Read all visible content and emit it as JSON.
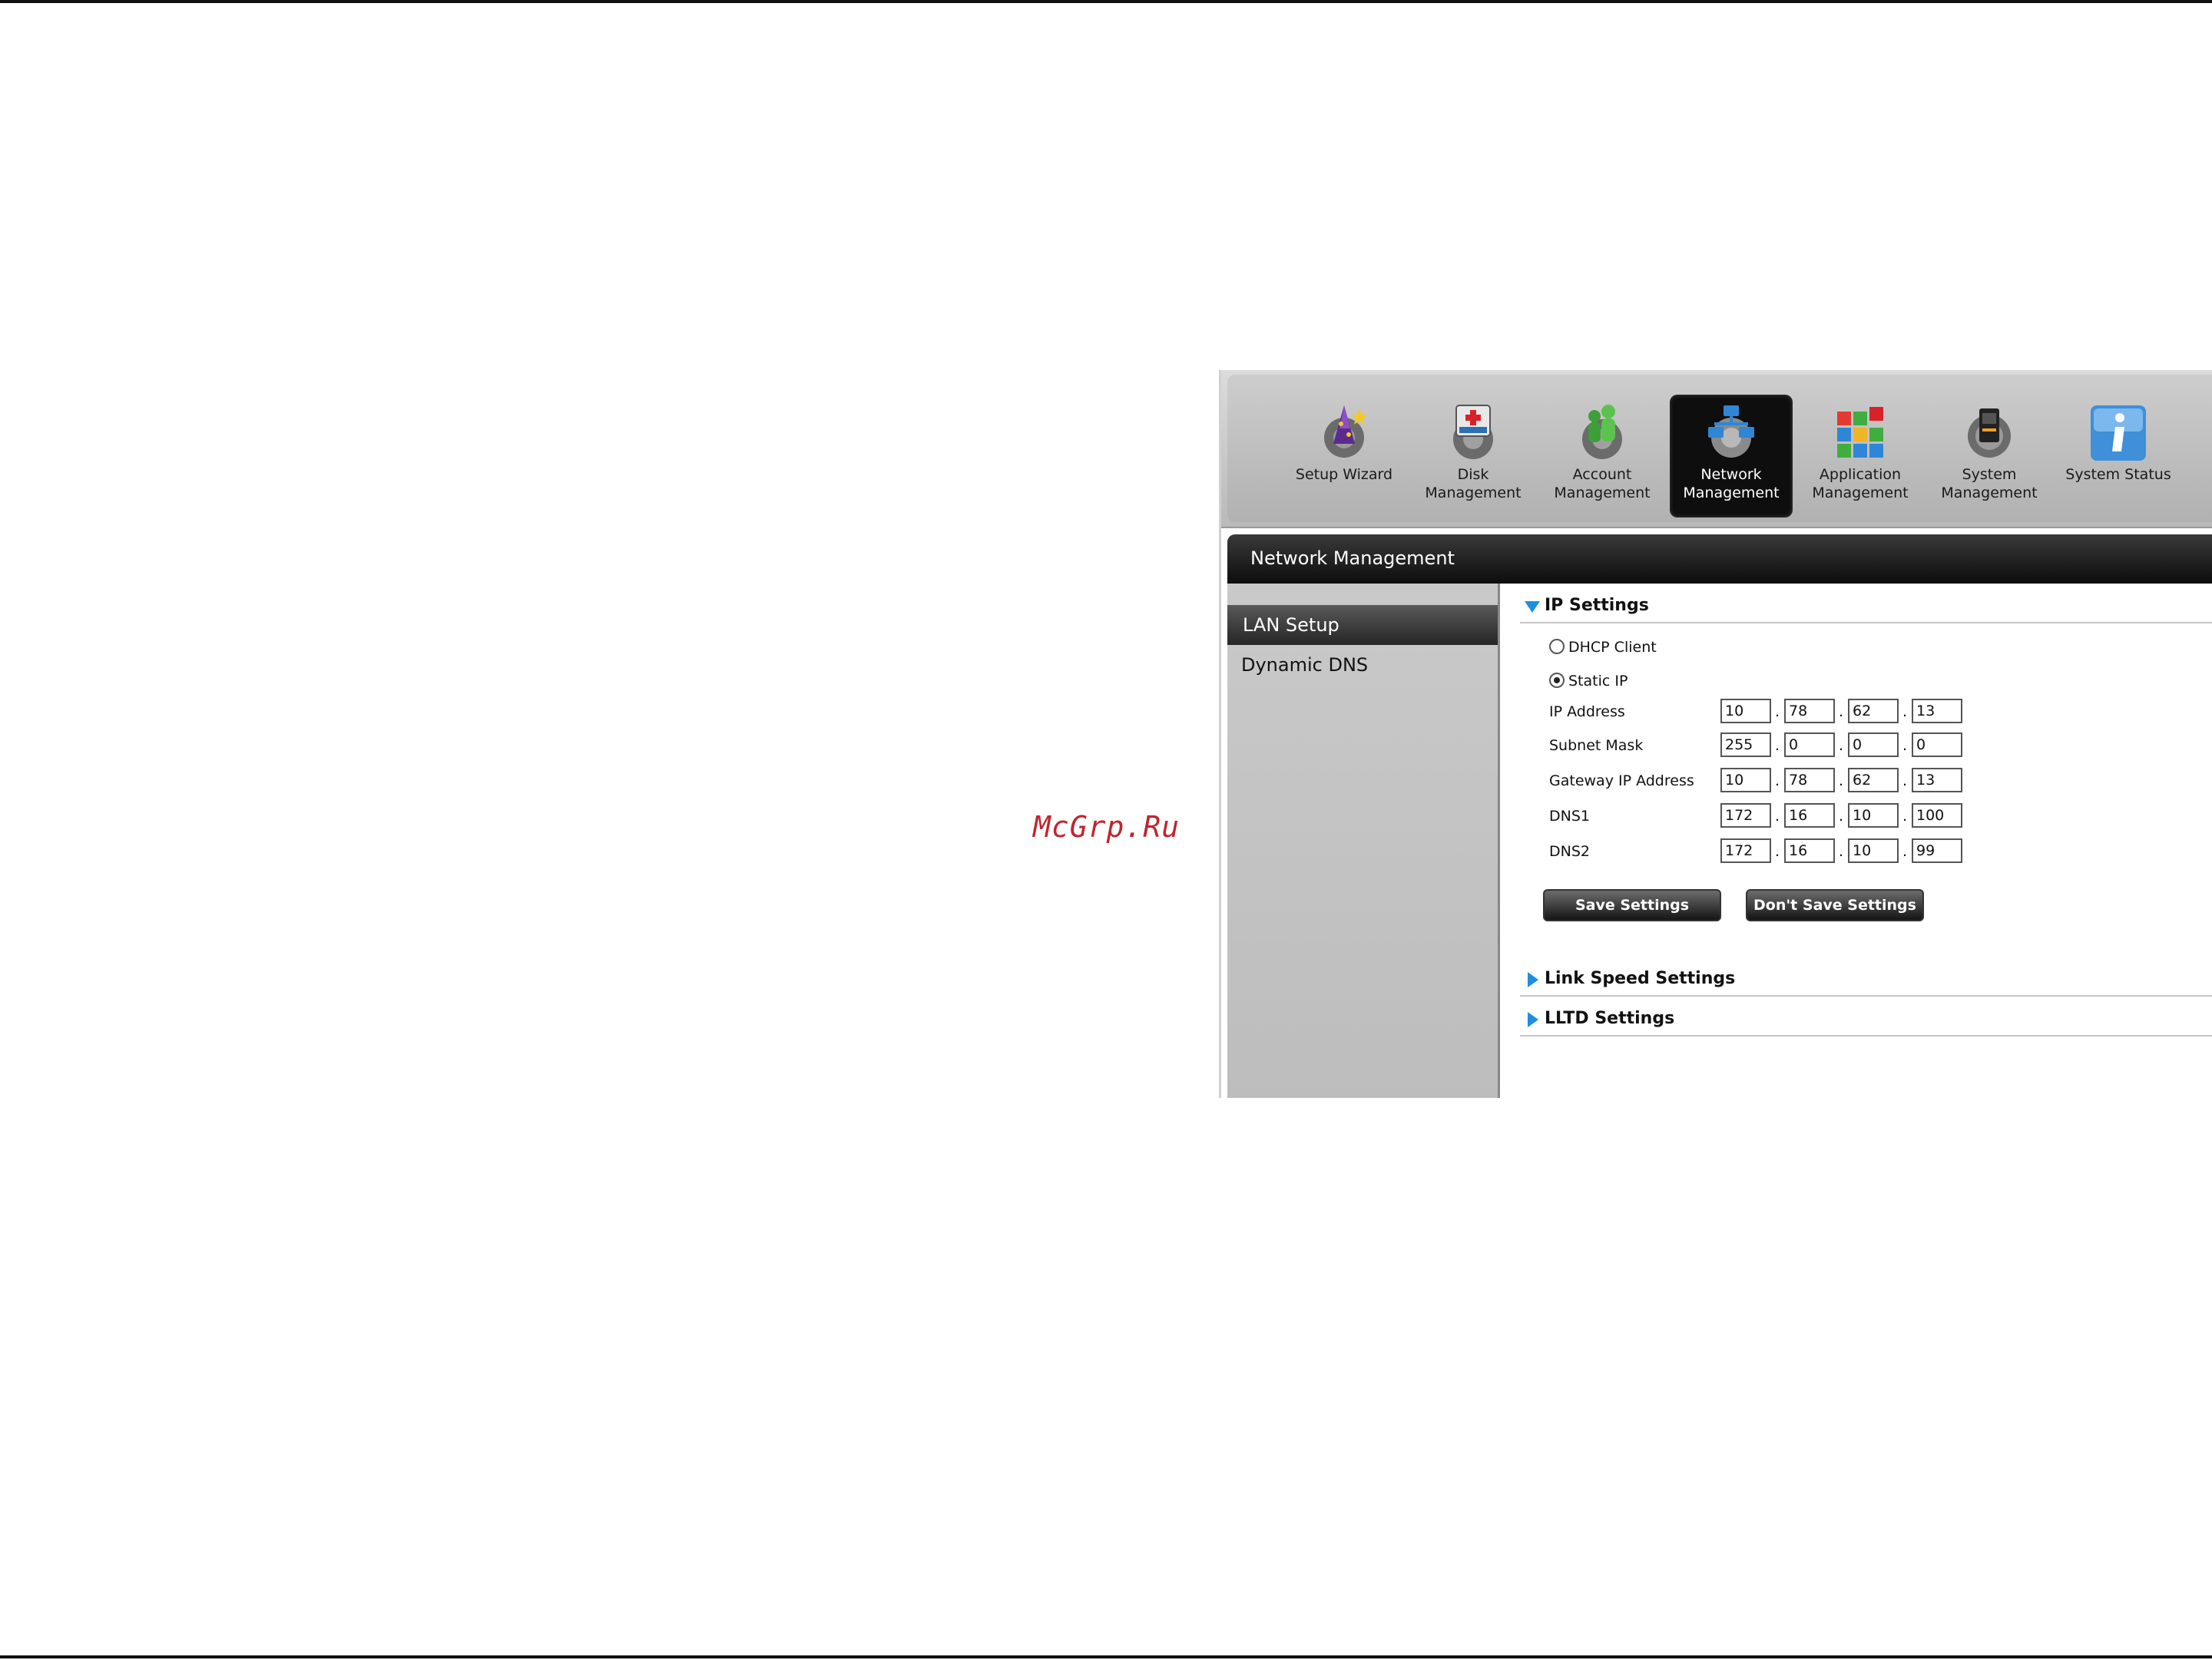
{
  "watermark": "McGrp.Ru",
  "toolbar": {
    "items": [
      {
        "label": "Setup Wizard",
        "icon": "wizard-icon"
      },
      {
        "label": "Disk Management",
        "icon": "disk-icon"
      },
      {
        "label": "Account\nManagement",
        "icon": "users-icon"
      },
      {
        "label": "Network\nManagement",
        "icon": "network-icon",
        "active": true
      },
      {
        "label": "Application\nManagement",
        "icon": "apps-icon"
      },
      {
        "label": "System\nManagement",
        "icon": "system-icon"
      },
      {
        "label": "System Status",
        "icon": "info-icon"
      }
    ]
  },
  "panel": {
    "title": "Network Management"
  },
  "sidebar": {
    "items": [
      "LAN Setup",
      "Dynamic DNS"
    ]
  },
  "ip_settings": {
    "title": "IP Settings",
    "dhcp_label": "DHCP Client",
    "static_label": "Static IP",
    "selected": "Static IP",
    "fields": [
      {
        "label": "IP Address",
        "octets": [
          "10",
          "78",
          "62",
          "13"
        ]
      },
      {
        "label": "Subnet Mask",
        "octets": [
          "255",
          "0",
          "0",
          "0"
        ]
      },
      {
        "label": "Gateway IP Address",
        "octets": [
          "10",
          "78",
          "62",
          "13"
        ]
      },
      {
        "label": "DNS1",
        "octets": [
          "172",
          "16",
          "10",
          "100"
        ]
      },
      {
        "label": "DNS2",
        "octets": [
          "172",
          "16",
          "10",
          "99"
        ]
      }
    ],
    "save_label": "Save Settings",
    "dont_save_label": "Don't Save Settings"
  },
  "sections": {
    "link_speed": "Link Speed Settings",
    "lltd": "LLTD Settings"
  },
  "colors": {
    "accent_arrow": "#1e8fe0",
    "watermark": "#c0262e"
  }
}
